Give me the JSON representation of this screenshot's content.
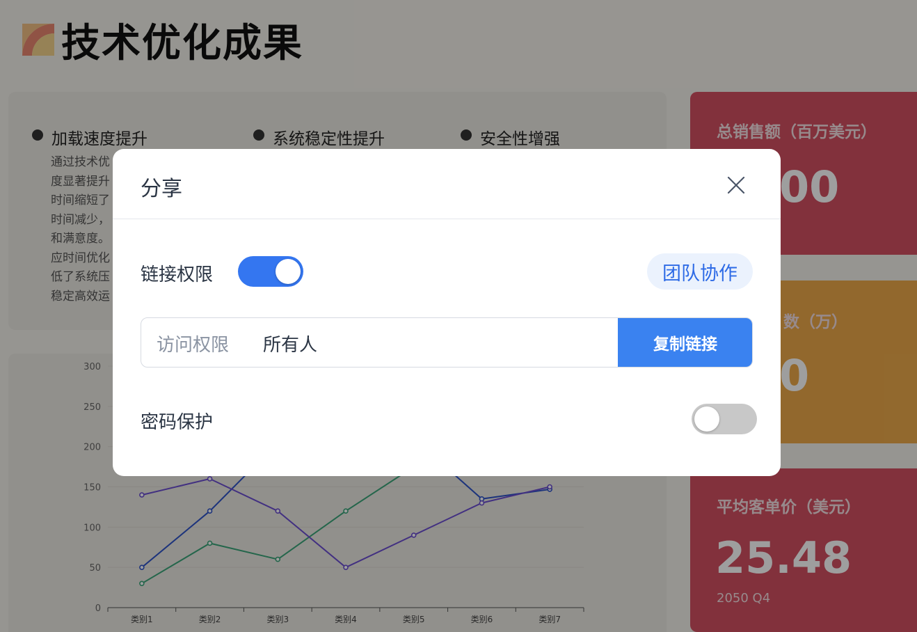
{
  "page": {
    "title": "技术优化成果"
  },
  "features": [
    {
      "title": "加载速度提升"
    },
    {
      "title": "系统稳定性提升"
    },
    {
      "title": "安全性增强"
    }
  ],
  "feature_description_lines": [
    "通过技术优",
    "度显著提升",
    "时间缩短了",
    "时间减少，",
    "和满意度。",
    "应时间优化",
    "低了系统压",
    "稳定高效运"
  ],
  "stats": [
    {
      "label": "总销售额（百万美元）",
      "value": "00"
    },
    {
      "label": "数（万）",
      "value": "0"
    },
    {
      "label": "平均客单价（美元）",
      "value": "25.48",
      "sub": "2050 Q4"
    }
  ],
  "chart_data": {
    "type": "line",
    "categories": [
      "类别1",
      "类别2",
      "类别3",
      "类别4",
      "类别5",
      "类别6",
      "类别7"
    ],
    "ylim": [
      0,
      300
    ],
    "yticks": [
      0,
      50,
      100,
      150,
      200,
      250,
      300
    ],
    "series": [
      {
        "values": [
          50,
          120,
          205,
          null,
          210,
          135,
          147
        ],
        "color": "#2f54c8"
      },
      {
        "values": [
          30,
          80,
          60,
          120,
          175,
          null,
          null
        ],
        "color": "#3aa57a"
      },
      {
        "values": [
          140,
          160,
          120,
          50,
          90,
          130,
          150
        ],
        "color": "#6b4ed0"
      }
    ],
    "grid": true
  },
  "modal": {
    "title": "分享",
    "link_permission_label": "链接权限",
    "link_permission_on": true,
    "team_button_label": "团队协作",
    "access_label": "访问权限",
    "access_value": "所有人",
    "copy_button_label": "复制链接",
    "password_label": "密码保护",
    "password_on": false
  },
  "colors": {
    "accent": "#3476f0",
    "stat_red": "#d24f61",
    "stat_orange": "#eca94a"
  }
}
